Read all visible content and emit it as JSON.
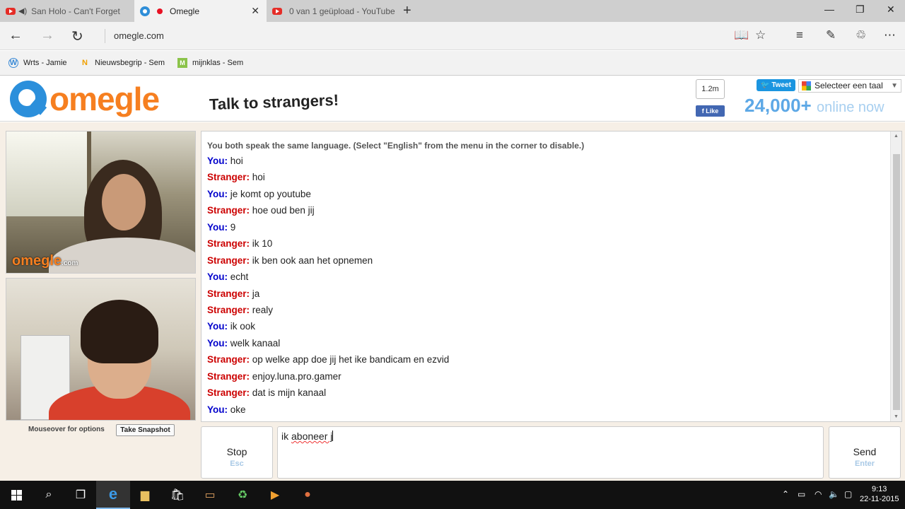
{
  "browser": {
    "tabs": [
      {
        "title": "San Holo - Can't Forget",
        "icon": "youtube-icon",
        "active": false
      },
      {
        "title": "Omegle",
        "icon": "omegle-icon",
        "active": true
      },
      {
        "title": "0 van 1 geüpload - YouTube",
        "icon": "youtube-icon",
        "active": false
      }
    ],
    "new_tab": "+",
    "address": "omegle.com",
    "favorites": [
      {
        "label": "Wrts - Jamie",
        "icon": "wrts-icon",
        "glyph": "W"
      },
      {
        "label": "Nieuwsbegrip - Sem",
        "icon": "nieuwsbegrip-icon",
        "glyph": "N"
      },
      {
        "label": "mijnklas - Sem",
        "icon": "mijnklas-icon",
        "glyph": "M"
      }
    ]
  },
  "omegle": {
    "logo": "omegle",
    "tagline": "Talk to strangers!",
    "share_count": "1.2m",
    "like_label": "Like",
    "tweet_label": "Tweet",
    "language_select": "Selecteer een taal",
    "online_count": "24,000+",
    "online_label": "online now",
    "watermark": "omegle",
    "watermark_suffix": ".com",
    "mouseover_text": "Mouseover for options",
    "snapshot_button": "Take Snapshot",
    "status_message": "You both speak the same language. (Select \"English\" from the menu in the corner to disable.)",
    "messages": [
      {
        "who": "You:",
        "role": "you",
        "text": "hoi"
      },
      {
        "who": "Stranger:",
        "role": "stranger",
        "text": "hoi"
      },
      {
        "who": "You:",
        "role": "you",
        "text": "je komt op youtube"
      },
      {
        "who": "Stranger:",
        "role": "stranger",
        "text": "hoe oud ben jij"
      },
      {
        "who": "You:",
        "role": "you",
        "text": "9"
      },
      {
        "who": "Stranger:",
        "role": "stranger",
        "text": "ik 10"
      },
      {
        "who": "Stranger:",
        "role": "stranger",
        "text": "ik ben ook aan het opnemen"
      },
      {
        "who": "You:",
        "role": "you",
        "text": "echt"
      },
      {
        "who": "Stranger:",
        "role": "stranger",
        "text": "ja"
      },
      {
        "who": "Stranger:",
        "role": "stranger",
        "text": "realy"
      },
      {
        "who": "You:",
        "role": "you",
        "text": "ik ook"
      },
      {
        "who": "You:",
        "role": "you",
        "text": "welk kanaal"
      },
      {
        "who": "Stranger:",
        "role": "stranger",
        "text": "op welke app doe jij het ike bandicam en ezvid"
      },
      {
        "who": "Stranger:",
        "role": "stranger",
        "text": "enjoy.luna.pro.gamer"
      },
      {
        "who": "Stranger:",
        "role": "stranger",
        "text": "dat is mijn kanaal"
      },
      {
        "who": "You:",
        "role": "you",
        "text": "oke"
      }
    ],
    "stop_button": {
      "label": "Stop",
      "key": "Esc"
    },
    "send_button": {
      "label": "Send",
      "key": "Enter"
    },
    "input_value_prefix": "ik ",
    "input_value_underlined": "aboneer j"
  },
  "taskbar": {
    "time": "9:13",
    "date": "22-11-2015"
  },
  "colors": {
    "you": "#0000cc",
    "stranger": "#cc0000",
    "omegle_orange": "#f67f20",
    "omegle_blue": "#2b8fdb"
  }
}
